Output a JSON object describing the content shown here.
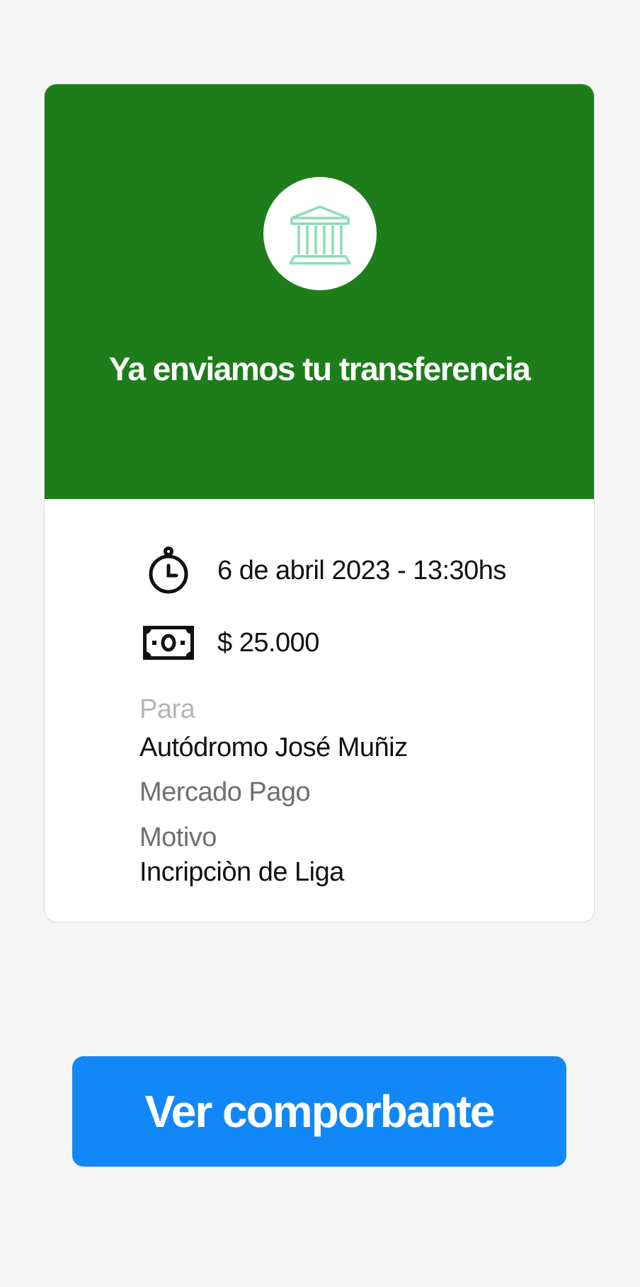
{
  "card": {
    "title": "Ya enviamos tu transferencia",
    "header_icon": "bank-icon",
    "colors": {
      "header_bg": "#1e7d1b",
      "icon_stroke": "#8fdcb8"
    },
    "date_time": {
      "icon": "stopwatch-icon",
      "text": "6 de abril 2023 - 13:30hs"
    },
    "amount": {
      "icon": "money-bill-icon",
      "text": "$ 25.000"
    },
    "recipient": {
      "label": "Para",
      "name": "Autódromo José Muñiz",
      "provider": "Mercado Pago"
    },
    "reason": {
      "label": "Motivo",
      "value": "Incripciòn de Liga"
    }
  },
  "actions": {
    "view_receipt_label": "Ver comporbante",
    "button_color": "#1288f8"
  }
}
